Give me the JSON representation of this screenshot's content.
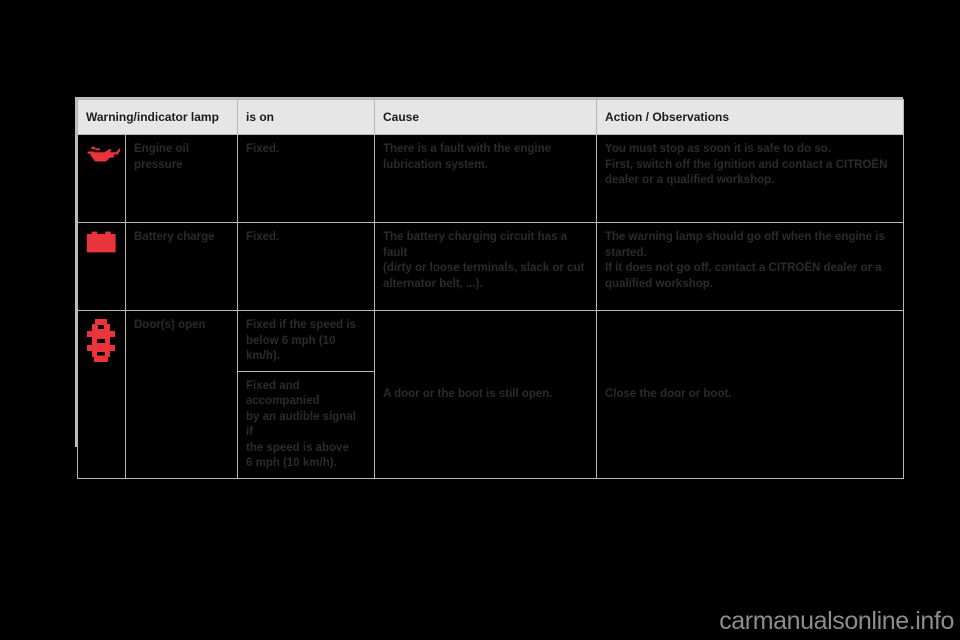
{
  "colors": {
    "page_background": "#000000",
    "table_border": "#bdbdbd",
    "header_background": "#e6e6e6",
    "lamp_name_background": "#f1f1f1",
    "warning_lamp_red": "#e8343a",
    "body_text": "#2b2b2b",
    "watermark": "#8d8d8d"
  },
  "table": {
    "headers": [
      "Warning/indicator lamp",
      "is on",
      "Cause",
      "Action / Observations"
    ],
    "rows": [
      {
        "icon_name": "engine-oil-pressure-icon",
        "lamp": "Engine oil pressure",
        "is_on": [
          "Fixed."
        ],
        "cause": [
          "There is a fault with the engine",
          "lubrication system."
        ],
        "action": [
          "You must stop as soon it is safe to do so.",
          "First, switch off the ignition and contact a CITROËN",
          "dealer or a qualified workshop."
        ]
      },
      {
        "icon_name": "battery-charge-icon",
        "lamp": "Battery charge",
        "is_on": [
          "Fixed."
        ],
        "cause": [
          "The battery charging circuit has a fault",
          "(dirty or loose terminals, slack or cut",
          "alternator belt, ...)."
        ],
        "action": [
          "The warning lamp should go off when the engine is",
          "started.",
          "If it does not go off, contact a CITROËN dealer or a",
          "qualified workshop."
        ]
      },
      {
        "icon_name": "doors-open-icon",
        "lamp": "Door(s) open",
        "is_on_sub": [
          [
            "Fixed if the speed is",
            "below 6 mph (10 km/h)."
          ],
          [
            "Fixed and accompanied",
            "by an audible signal if",
            "the speed is above",
            "6 mph (10 km/h)."
          ]
        ],
        "cause": [
          "A door or the boot is still open."
        ],
        "action": [
          "Close the door or boot."
        ]
      }
    ]
  },
  "watermark": {
    "text": "carmanualsonline.info"
  }
}
